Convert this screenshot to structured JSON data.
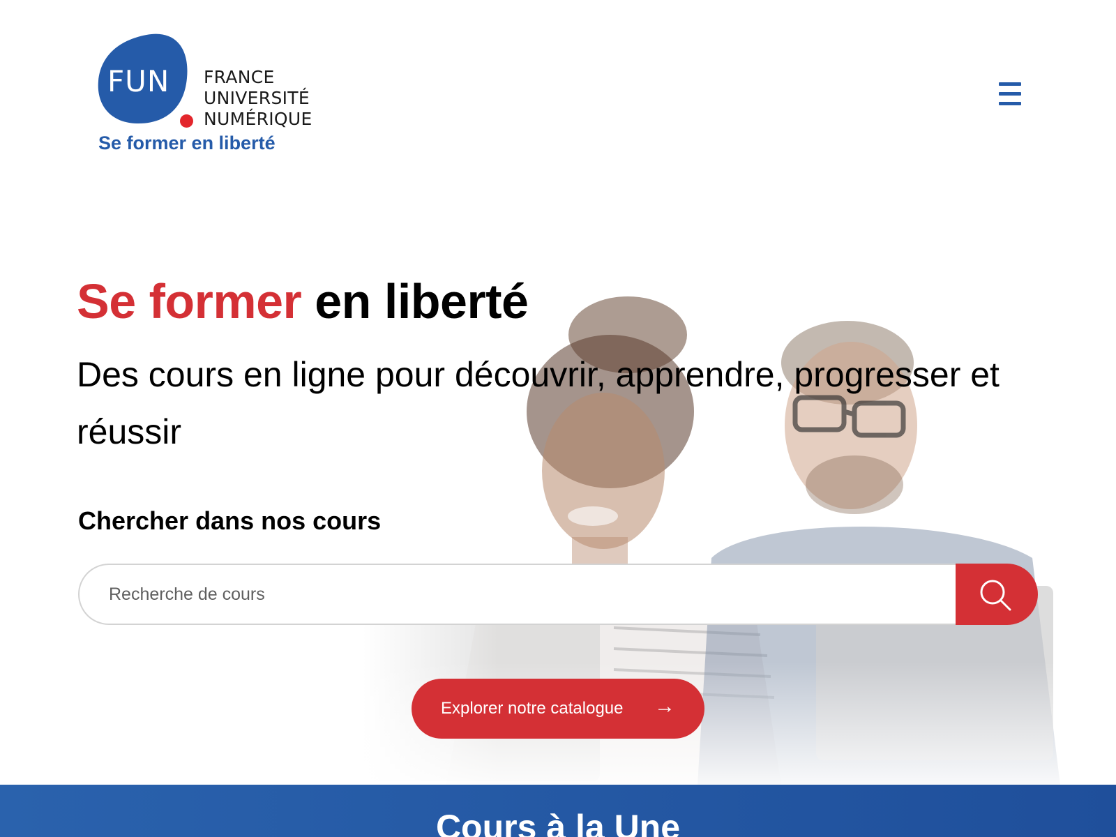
{
  "header": {
    "logo": {
      "short": "FUN",
      "lines": [
        "FRANCE",
        "UNIVERSITÉ",
        "NUMÉRIQUE"
      ],
      "tagline": "Se former en liberté"
    },
    "menu_icon": "hamburger-menu-icon"
  },
  "hero": {
    "title_red": "Se former",
    "title_black": "en liberté",
    "subtitle": "Des cours en ligne pour découvrir, apprendre, progresser et réussir",
    "search_label": "Chercher dans nos cours",
    "search": {
      "placeholder": "Recherche de cours",
      "value": "",
      "button_icon": "search-icon"
    },
    "explore_button": {
      "label": "Explorer notre catalogue",
      "arrow": "→"
    }
  },
  "featured": {
    "title": "Cours à la Une"
  },
  "colors": {
    "brand_blue": "#255ba9",
    "brand_red": "#d43035",
    "band_blue": "#2a62ad"
  }
}
